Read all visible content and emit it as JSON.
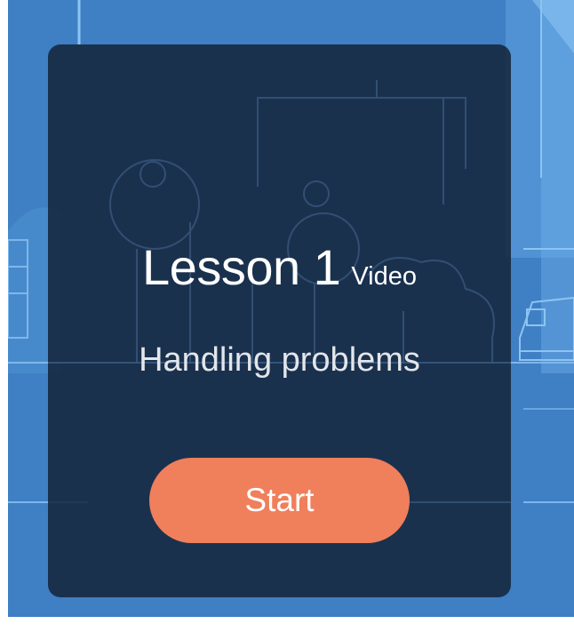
{
  "lesson": {
    "title": "Lesson 1",
    "type": "Video",
    "subtitle": "Handling problems"
  },
  "actions": {
    "start_label": "Start"
  },
  "colors": {
    "background_blue": "#3f7fc4",
    "card_overlay": "#14243a",
    "start_button": "#f07f5b",
    "text": "#ffffff"
  },
  "icons": {
    "background": "line-art-street-illustration"
  }
}
